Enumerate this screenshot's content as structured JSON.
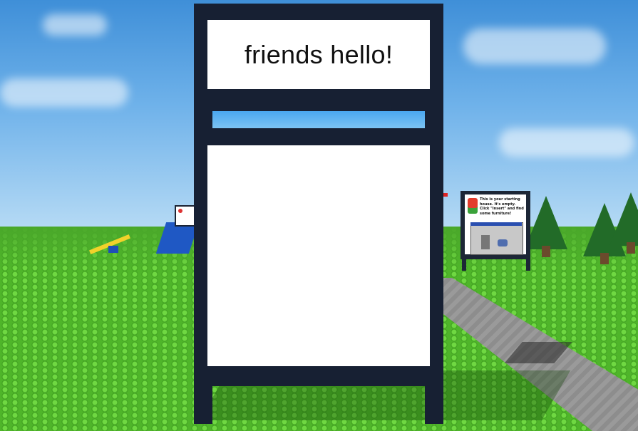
{
  "sign": {
    "title_text": "friends hello!"
  },
  "info_board": {
    "text": "This is your starting house. It's empty. Click \"Insert\" and find some furniture!"
  },
  "colors": {
    "sky": "#5aa6e4",
    "grass": "#4fb52a",
    "sign_frame": "#172033",
    "sign_panel": "#ffffff"
  },
  "icons": [
    "tree-icon",
    "seesaw-icon",
    "slide-icon"
  ]
}
